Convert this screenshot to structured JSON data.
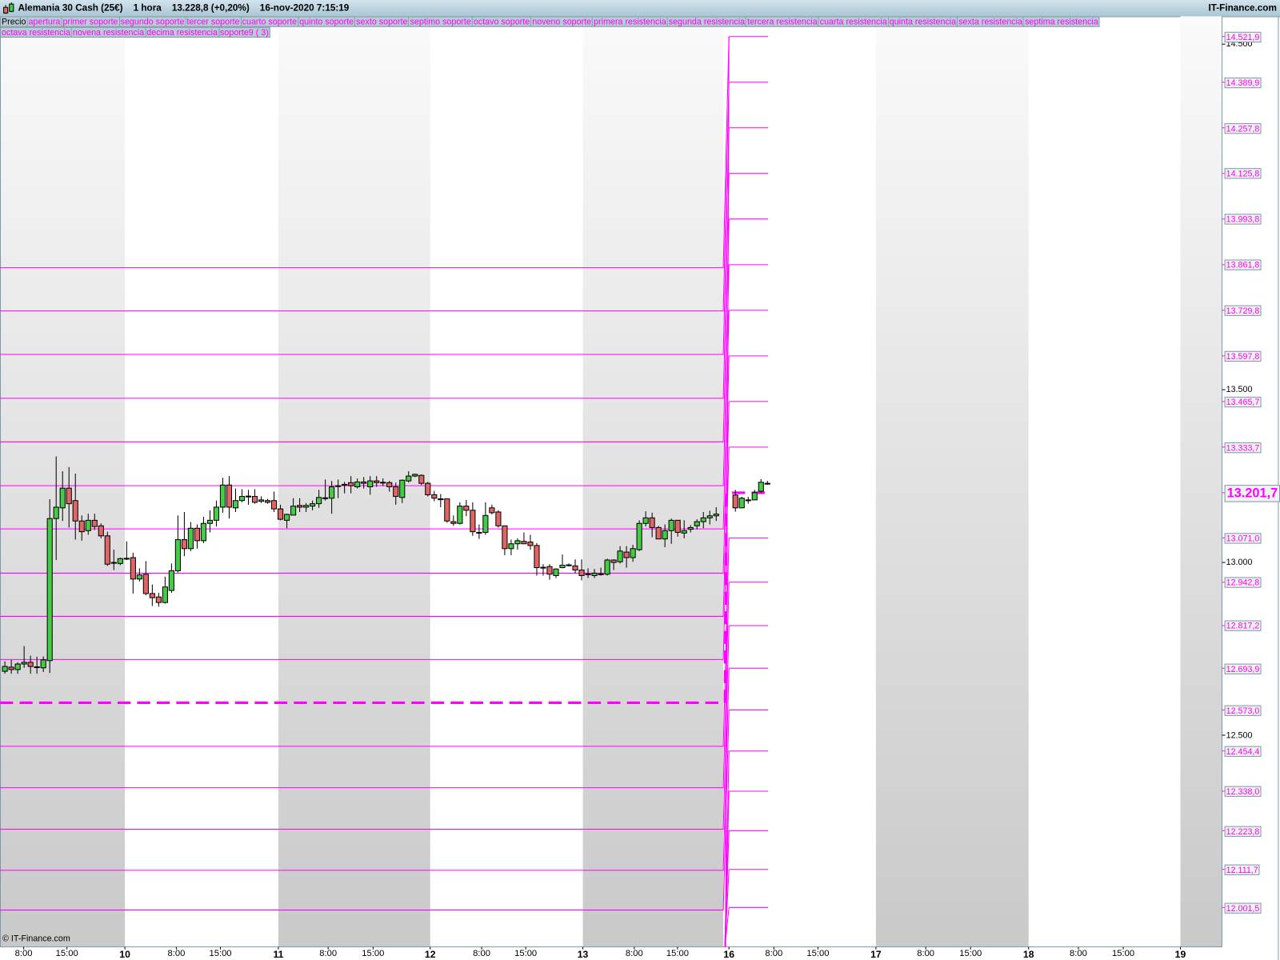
{
  "window": {
    "instrument": "Alemania 30 Cash (25€)",
    "timeframe": "1 hora",
    "price": "13.228,8 (+0,20%)",
    "datetime": "16-nov-2020 7:15:19",
    "brand": "IT-Finance.com",
    "copyright": "© IT-Finance.com"
  },
  "legend": {
    "row1": [
      "Precio",
      "apertura",
      "primer soporte",
      "segundo soporte",
      "tercer soporte",
      "cuarto soporte",
      "quinto soporte",
      "sexto soporte",
      "septimo soporte",
      "octavo soporte",
      "noveno soporte",
      "primera resistencia",
      "segunda resistencia",
      "tercera resistencia",
      "cuarta resistencia",
      "quinta resistencia",
      "sexta resistencia",
      "septima resistencia"
    ],
    "row2": [
      "octava resistencia",
      "novena resistencia",
      "decima resistencia",
      "soporte9 ( 3)"
    ]
  },
  "colors": {
    "level": "#ff00ff",
    "up": "#44cc44",
    "down": "#e06666",
    "band": "#cccccc",
    "axis": "#7f99a6"
  },
  "chart_data": {
    "type": "candlestick",
    "price_axis_ticks": [
      "14.500",
      "13.500",
      "13.000",
      "12.500"
    ],
    "price_axis_tick_values": [
      14500,
      13500,
      13000,
      12500
    ],
    "time_labels": [
      {
        "t": "8:00",
        "day": false,
        "slot": 0
      },
      {
        "t": "15:00",
        "day": false,
        "slot": 1
      },
      {
        "t": "10",
        "day": true,
        "slot": 2
      },
      {
        "t": "8:00",
        "day": false,
        "slot": 3
      },
      {
        "t": "15:00",
        "day": false,
        "slot": 4
      },
      {
        "t": "11",
        "day": true,
        "slot": 5
      },
      {
        "t": "8:00",
        "day": false,
        "slot": 6
      },
      {
        "t": "15:00",
        "day": false,
        "slot": 7
      },
      {
        "t": "12",
        "day": true,
        "slot": 8
      },
      {
        "t": "8:00",
        "day": false,
        "slot": 9
      },
      {
        "t": "15:00",
        "day": false,
        "slot": 10
      },
      {
        "t": "13",
        "day": true,
        "slot": 11
      },
      {
        "t": "8:00",
        "day": false,
        "slot": 12
      },
      {
        "t": "15:00",
        "day": false,
        "slot": 13
      },
      {
        "t": "16",
        "day": true,
        "slot": 14
      },
      {
        "t": "8:00",
        "day": false,
        "slot": 15
      },
      {
        "t": "15:00",
        "day": false,
        "slot": 16
      },
      {
        "t": "17",
        "day": true,
        "slot": 17
      },
      {
        "t": "8:00",
        "day": false,
        "slot": 18
      },
      {
        "t": "15:00",
        "day": false,
        "slot": 19
      },
      {
        "t": "18",
        "day": true,
        "slot": 20
      },
      {
        "t": "8:00",
        "day": false,
        "slot": 21
      },
      {
        "t": "15:00",
        "day": false,
        "slot": 22
      },
      {
        "t": "19",
        "day": true,
        "slot": 23
      }
    ],
    "candles_prev_week_ohlc": [
      [
        12685,
        12714,
        12678,
        12699
      ],
      [
        12697,
        12718,
        12678,
        12690
      ],
      [
        12690,
        12711,
        12678,
        12706
      ],
      [
        12706,
        12758,
        12695,
        12711
      ],
      [
        12711,
        12730,
        12678,
        12699
      ],
      [
        12697,
        12727,
        12678,
        12698
      ],
      [
        12695,
        12728,
        12683,
        12718
      ],
      [
        12716,
        13183,
        12680,
        13127
      ],
      [
        13127,
        13307,
        13007,
        13160
      ],
      [
        13158,
        13264,
        13120,
        13215
      ],
      [
        13215,
        13276,
        13101,
        13170
      ],
      [
        13179,
        13257,
        13066,
        13120
      ],
      [
        13120,
        13136,
        13063,
        13089
      ],
      [
        13092,
        13141,
        13080,
        13122
      ],
      [
        13122,
        13141,
        13094,
        13104
      ],
      [
        13106,
        13113,
        13070,
        13077
      ],
      [
        13077,
        13089,
        12990,
        12995
      ],
      [
        13000,
        13037,
        12978,
        12998
      ],
      [
        12997,
        13014,
        12992,
        13011
      ],
      [
        13011,
        13061,
        13007,
        13012
      ],
      [
        13014,
        13028,
        12910,
        12952
      ],
      [
        12952,
        12983,
        12945,
        12964
      ],
      [
        12966,
        13004,
        12905,
        12910
      ],
      [
        12910,
        12936,
        12874,
        12898
      ],
      [
        12900,
        12912,
        12872,
        12884
      ],
      [
        12884,
        12959,
        12881,
        12929
      ],
      [
        12919,
        12997,
        12912,
        12976
      ],
      [
        12976,
        13136,
        12971,
        13066
      ],
      [
        13066,
        13146,
        13018,
        13040
      ],
      [
        13040,
        13117,
        13033,
        13099
      ],
      [
        13099,
        13110,
        13040,
        13063
      ],
      [
        13063,
        13132,
        13056,
        13113
      ],
      [
        13113,
        13151,
        13087,
        13122
      ],
      [
        13122,
        13179,
        13104,
        13160
      ],
      [
        13160,
        13245,
        13144,
        13224
      ],
      [
        13224,
        13250,
        13127,
        13160
      ],
      [
        13158,
        13214,
        13146,
        13179
      ],
      [
        13179,
        13212,
        13174,
        13191
      ],
      [
        13191,
        13210,
        13167,
        13192
      ],
      [
        13191,
        13212,
        13170,
        13174
      ],
      [
        13177,
        13191,
        13172,
        13181
      ],
      [
        13179,
        13184,
        13170,
        13174
      ],
      [
        13179,
        13205,
        13146,
        13155
      ],
      [
        13155,
        13167,
        13122,
        13125
      ],
      [
        13122,
        13141,
        13099,
        13139
      ],
      [
        13137,
        13186,
        13137,
        13163
      ],
      [
        13165,
        13186,
        13146,
        13160
      ],
      [
        13160,
        13172,
        13146,
        13165
      ],
      [
        13163,
        13179,
        13151,
        13170
      ],
      [
        13170,
        13210,
        13158,
        13188
      ],
      [
        13186,
        13240,
        13179,
        13187
      ],
      [
        13186,
        13236,
        13141,
        13219
      ],
      [
        13221,
        13240,
        13186,
        13222
      ],
      [
        13224,
        13233,
        13200,
        13226
      ],
      [
        13231,
        13250,
        13200,
        13222
      ],
      [
        13219,
        13243,
        13214,
        13233
      ],
      [
        13233,
        13247,
        13214,
        13229
      ],
      [
        13219,
        13250,
        13196,
        13236
      ],
      [
        13236,
        13250,
        13219,
        13231
      ],
      [
        13231,
        13243,
        13221,
        13232
      ],
      [
        13231,
        13236,
        13205,
        13219
      ],
      [
        13219,
        13231,
        13167,
        13191
      ],
      [
        13188,
        13240,
        13172,
        13238
      ],
      [
        13236,
        13264,
        13231,
        13250
      ],
      [
        13250,
        13257,
        13247,
        13255
      ],
      [
        13252,
        13255,
        13224,
        13229
      ],
      [
        13229,
        13233,
        13191,
        13196
      ],
      [
        13196,
        13207,
        13177,
        13186
      ],
      [
        13184,
        13198,
        13160,
        13183
      ],
      [
        13184,
        13184,
        13115,
        13120
      ],
      [
        13118,
        13136,
        13106,
        13113
      ],
      [
        13113,
        13174,
        13110,
        13163
      ],
      [
        13163,
        13181,
        13134,
        13151
      ],
      [
        13151,
        13174,
        13077,
        13089
      ],
      [
        13087,
        13110,
        13068,
        13086
      ],
      [
        13087,
        13174,
        13080,
        13136
      ],
      [
        13158,
        13167,
        13139,
        13144
      ],
      [
        13146,
        13151,
        13101,
        13106
      ],
      [
        13106,
        13106,
        13021,
        13040
      ],
      [
        13040,
        13066,
        13021,
        13054
      ],
      [
        13054,
        13070,
        13037,
        13063
      ],
      [
        13061,
        13087,
        13054,
        13054
      ],
      [
        13059,
        13080,
        13037,
        13049
      ],
      [
        13049,
        13056,
        12962,
        12985
      ],
      [
        12986,
        12995,
        12962,
        12985
      ],
      [
        12988,
        12995,
        12950,
        12966
      ],
      [
        12962,
        12983,
        12955,
        12981
      ],
      [
        12985,
        13023,
        12983,
        12992
      ],
      [
        12993,
        12997,
        12988,
        12992
      ],
      [
        12990,
        13009,
        12969,
        12978
      ],
      [
        12978,
        13009,
        12948,
        12962
      ],
      [
        12967,
        12983,
        12955,
        12966
      ],
      [
        12962,
        12981,
        12955,
        12969
      ],
      [
        12967,
        12985,
        12962,
        12966
      ],
      [
        12966,
        13011,
        12962,
        13007
      ],
      [
        13007,
        13009,
        12978,
        13000
      ],
      [
        13002,
        13047,
        12997,
        13033
      ],
      [
        13030,
        13047,
        12985,
        13014
      ],
      [
        13014,
        13051,
        13002,
        13040
      ],
      [
        13037,
        13122,
        13033,
        13113
      ],
      [
        13113,
        13148,
        13104,
        13129
      ],
      [
        13129,
        13144,
        13073,
        13101
      ],
      [
        13101,
        13106,
        13068,
        13068
      ],
      [
        13068,
        13110,
        13044,
        13092
      ],
      [
        13092,
        13127,
        13054,
        13122
      ],
      [
        13122,
        13122,
        13075,
        13087
      ],
      [
        13085,
        13122,
        13070,
        13092
      ],
      [
        13096,
        13108,
        13087,
        13101
      ],
      [
        13106,
        13125,
        13096,
        13118
      ],
      [
        13118,
        13146,
        13099,
        13129
      ],
      [
        13129,
        13150,
        13110,
        13135
      ],
      [
        13135,
        13160,
        13120,
        13140
      ]
    ],
    "candles_nov16_ohlc": [
      [
        13195,
        13210,
        13147,
        13158
      ],
      [
        13158,
        13190,
        13158,
        13186
      ],
      [
        13181,
        13190,
        13170,
        13180
      ],
      [
        13181,
        13210,
        13181,
        13202
      ],
      [
        13206,
        13241,
        13201,
        13232
      ],
      [
        13229,
        13236,
        13225,
        13229
      ]
    ],
    "prev_levels": [
      13853,
      13728,
      13602,
      13475,
      13349,
      13222,
      13097,
      12969,
      12844,
      12719,
      12468,
      12348,
      12228,
      12109,
      11994
    ],
    "prev_dashed_level": 12594,
    "current_levels": [
      "14.521,9",
      "14.389,9",
      "14.257,8",
      "14.125,8",
      "13.993,8",
      "13.861,8",
      "13.729,8",
      "13.597,8",
      "13.465,7",
      "13.333,7",
      "13.071,0",
      "12.942,8",
      "12.817,2",
      "12.693,9",
      "12.573,0",
      "12.454,4",
      "12.338,0",
      "12.223,8",
      "12.111,7",
      "12.001,5"
    ],
    "current_dashed_level": "13.201,7"
  }
}
